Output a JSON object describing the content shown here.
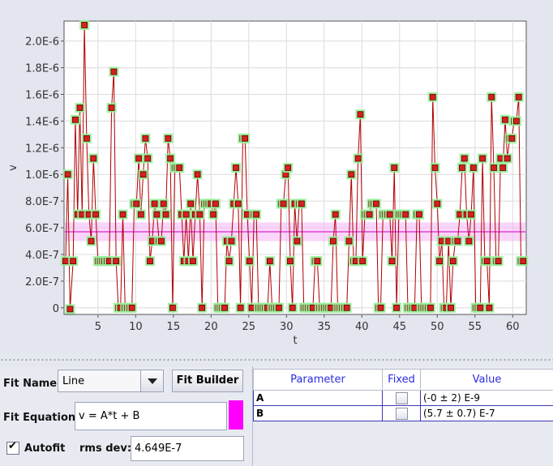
{
  "chart_data": {
    "type": "line",
    "xlabel": "t",
    "ylabel": "v",
    "xlim": [
      0.5,
      61.8
    ],
    "ylim": [
      -5e-08,
      2.15e-06
    ],
    "x_ticks": [
      5,
      10,
      15,
      20,
      25,
      30,
      35,
      40,
      45,
      50,
      55,
      60
    ],
    "y_ticks": [
      {
        "value": 0,
        "label": "0"
      },
      {
        "value": 2e-07,
        "label": "2.0E-7"
      },
      {
        "value": 4e-07,
        "label": "4.0E-7"
      },
      {
        "value": 6e-07,
        "label": "6.0E-7"
      },
      {
        "value": 8e-07,
        "label": "8.0E-7"
      },
      {
        "value": 1e-06,
        "label": "1.0E-6"
      },
      {
        "value": 1.2e-06,
        "label": "1.2E-6"
      },
      {
        "value": 1.4e-06,
        "label": "1.4E-6"
      },
      {
        "value": 1.6e-06,
        "label": "1.6E-6"
      },
      {
        "value": 1.8e-06,
        "label": "1.8E-6"
      },
      {
        "value": 2e-06,
        "label": "2.0E-6"
      }
    ],
    "grid": true,
    "series_color": "#b00000",
    "marker_fill": "#d42020",
    "marker_highlight": "#98f098",
    "fit_line_color": "#e040e0",
    "fit_band_color": "#f6b4f6",
    "fit": {
      "slope": -0.0,
      "intercept": 5.7e-07,
      "band": 7e-08
    },
    "x": [
      0.7,
      1.0,
      1.3,
      1.7,
      2.0,
      2.3,
      2.6,
      2.9,
      3.2,
      3.5,
      3.8,
      4.1,
      4.4,
      4.7,
      5.0,
      5.3,
      5.6,
      5.9,
      6.2,
      6.5,
      6.8,
      7.1,
      7.4,
      7.7,
      8.0,
      8.3,
      8.6,
      8.9,
      9.2,
      9.5,
      9.8,
      10.1,
      10.4,
      10.7,
      11.0,
      11.3,
      11.6,
      11.9,
      12.2,
      12.5,
      12.8,
      13.1,
      13.4,
      13.7,
      14.0,
      14.3,
      14.6,
      14.9,
      15.2,
      15.5,
      15.8,
      16.1,
      16.4,
      16.7,
      17.0,
      17.3,
      17.6,
      17.9,
      18.2,
      18.5,
      18.8,
      19.1,
      19.4,
      19.7,
      20.0,
      20.3,
      20.6,
      20.9,
      21.2,
      21.5,
      21.8,
      22.1,
      22.4,
      22.7,
      23.0,
      23.3,
      23.6,
      23.9,
      24.2,
      24.5,
      24.8,
      25.1,
      25.4,
      25.7,
      26.0,
      26.3,
      26.6,
      26.9,
      27.2,
      27.5,
      27.8,
      28.1,
      28.4,
      28.7,
      29.0,
      29.3,
      29.6,
      29.9,
      30.2,
      30.5,
      30.8,
      31.1,
      31.4,
      31.7,
      32.0,
      32.3,
      32.6,
      32.9,
      33.2,
      33.5,
      33.8,
      34.1,
      34.4,
      34.7,
      35.0,
      35.3,
      35.6,
      35.9,
      36.2,
      36.5,
      36.8,
      37.1,
      37.4,
      37.7,
      38.0,
      38.3,
      38.6,
      38.9,
      39.2,
      39.5,
      39.8,
      40.1,
      40.4,
      40.7,
      41.0,
      41.3,
      41.6,
      41.9,
      42.2,
      42.5,
      42.8,
      43.1,
      43.4,
      43.7,
      44.0,
      44.3,
      44.6,
      44.9,
      45.2,
      45.5,
      45.8,
      46.1,
      46.4,
      46.7,
      47.0,
      47.3,
      47.6,
      47.9,
      48.2,
      48.5,
      48.8,
      49.1,
      49.4,
      49.7,
      50.0,
      50.3,
      50.6,
      50.9,
      51.2,
      51.5,
      51.8,
      52.1,
      52.4,
      52.7,
      53.0,
      53.3,
      53.6,
      53.9,
      54.2,
      54.5,
      54.8,
      55.1,
      55.4,
      55.7,
      56.0,
      56.3,
      56.6,
      56.9,
      57.2,
      57.5,
      57.8,
      58.1,
      58.4,
      58.7,
      59.0,
      59.3,
      59.6,
      59.9,
      60.2,
      60.5,
      60.8,
      61.1,
      61.4
    ],
    "y": [
      3.5e-07,
      1e-06,
      -1e-08,
      3.5e-07,
      1.41e-06,
      7e-07,
      1.5e-06,
      7e-07,
      2.12e-06,
      1.27e-06,
      7e-07,
      5e-07,
      1.12e-06,
      7e-07,
      3.5e-07,
      3.5e-07,
      3.5e-07,
      3.5e-07,
      3.5e-07,
      3.5e-07,
      1.5e-06,
      1.77e-06,
      3.5e-07,
      0,
      0,
      7e-07,
      0,
      0,
      0,
      0,
      7.8e-07,
      7.8e-07,
      1.12e-06,
      7e-07,
      1e-06,
      1.27e-06,
      1.12e-06,
      3.5e-07,
      5e-07,
      7.8e-07,
      7e-07,
      5e-07,
      5e-07,
      7.8e-07,
      7e-07,
      1.27e-06,
      1.12e-06,
      0,
      1.05e-06,
      1.05e-06,
      1.05e-06,
      7e-07,
      3.5e-07,
      7e-07,
      3.5e-07,
      7.8e-07,
      3.5e-07,
      7e-07,
      1e-06,
      7e-07,
      0,
      7.8e-07,
      7.8e-07,
      7.8e-07,
      7.8e-07,
      7e-07,
      7.8e-07,
      0,
      0,
      0,
      0,
      5e-07,
      3.5e-07,
      5e-07,
      7.8e-07,
      1.05e-06,
      7.8e-07,
      0,
      1.27e-06,
      1.27e-06,
      7e-07,
      3.5e-07,
      0,
      7e-07,
      7e-07,
      0,
      0,
      0,
      0,
      0,
      3.5e-07,
      0,
      0,
      0,
      0,
      7.8e-07,
      7.8e-07,
      1e-06,
      1.05e-06,
      3.5e-07,
      0,
      7.8e-07,
      5e-07,
      7.8e-07,
      7.8e-07,
      0,
      0,
      0,
      0,
      0,
      3.5e-07,
      3.5e-07,
      0,
      0,
      0,
      0,
      0,
      0,
      5e-07,
      7e-07,
      0,
      0,
      0,
      0,
      0,
      5e-07,
      1e-06,
      3.5e-07,
      3.5e-07,
      1.12e-06,
      1.45e-06,
      3.5e-07,
      7e-07,
      7e-07,
      7e-07,
      7.8e-07,
      7.8e-07,
      7.8e-07,
      0,
      0,
      7e-07,
      7e-07,
      7e-07,
      7e-07,
      3.5e-07,
      1.05e-06,
      0,
      7e-07,
      7e-07,
      7e-07,
      7e-07,
      0,
      0,
      0,
      0,
      7e-07,
      7e-07,
      0,
      0,
      0,
      0,
      0,
      1.58e-06,
      1.05e-06,
      7.8e-07,
      3.5e-07,
      5e-07,
      0,
      0,
      5e-07,
      0,
      3.5e-07,
      5e-07,
      5e-07,
      7e-07,
      1.05e-06,
      1.12e-06,
      7e-07,
      5e-07,
      7e-07,
      1.05e-06,
      0,
      0,
      0,
      1.12e-06,
      3.5e-07,
      3.5e-07,
      0,
      1.58e-06,
      1.05e-06,
      3.5e-07,
      3.5e-07,
      1.12e-06,
      1.05e-06,
      1.41e-06,
      1.12e-06,
      1.27e-06,
      1.27e-06,
      1.4e-06,
      1.4e-06,
      1.58e-06,
      3.5e-07,
      3.5e-07
    ]
  },
  "fit": {
    "name_label": "Fit Name:",
    "name_value": "Line",
    "builder_label": "Fit Builder",
    "equation_label": "Fit Equation:",
    "equation_value": "v = A*t + B",
    "autofit_label": "Autofit",
    "rms_label": "rms dev:",
    "rms_value": "4.649E-7",
    "curve_color": "#ff00ff"
  },
  "params": {
    "headers": {
      "parameter": "Parameter",
      "fixed": "Fixed",
      "value": "Value"
    },
    "rows": [
      {
        "name": "A",
        "fixed": false,
        "value": "(-0 ± 2) E-9"
      },
      {
        "name": "B",
        "fixed": false,
        "value": "(5.7 ± 0.7) E-7"
      }
    ]
  }
}
